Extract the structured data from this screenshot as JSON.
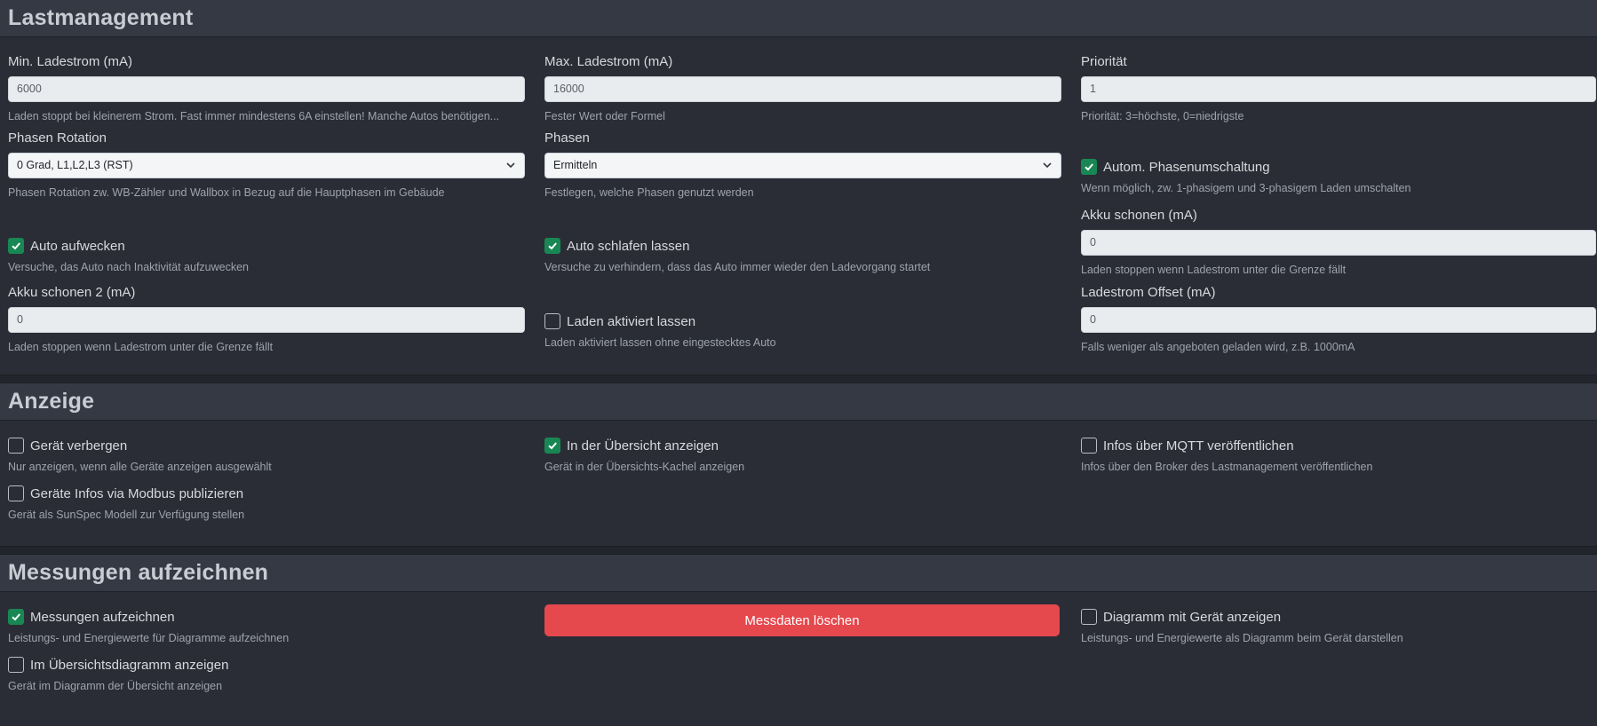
{
  "lastmanagement": {
    "title": "Lastmanagement",
    "min_ladestrom": {
      "label": "Min. Ladestrom (mA)",
      "value": "6000",
      "help": "Laden stoppt bei kleinerem Strom. Fast immer mindestens 6A einstellen! Manche Autos benötigen..."
    },
    "max_ladestrom": {
      "label": "Max. Ladestrom (mA)",
      "value": "16000",
      "help": "Fester Wert oder Formel"
    },
    "prioritaet": {
      "label": "Priorität",
      "value": "1",
      "help": "Priorität: 3=höchste, 0=niedrigste"
    },
    "phasen_rotation": {
      "label": "Phasen Rotation",
      "value": "0 Grad, L1,L2,L3 (RST)",
      "help": "Phasen Rotation zw. WB-Zähler und Wallbox in Bezug auf die Hauptphasen im Gebäude"
    },
    "phasen": {
      "label": "Phasen",
      "value": "Ermitteln",
      "help": "Festlegen, welche Phasen genutzt werden"
    },
    "autom_phasenumschaltung": {
      "label": "Autom. Phasenumschaltung",
      "checked": true,
      "help": "Wenn möglich, zw. 1-phasigem und 3-phasigem Laden umschalten"
    },
    "auto_aufwecken": {
      "label": "Auto aufwecken",
      "checked": true,
      "help": "Versuche, das Auto nach Inaktivität aufzuwecken"
    },
    "auto_schlafen": {
      "label": "Auto schlafen lassen",
      "checked": true,
      "help": "Versuche zu verhindern, dass das Auto immer wieder den Ladevorgang startet"
    },
    "akku_schonen": {
      "label": "Akku schonen (mA)",
      "value": "0",
      "help": "Laden stoppen wenn Ladestrom unter die Grenze fällt"
    },
    "akku_schonen2": {
      "label": "Akku schonen 2 (mA)",
      "value": "0",
      "help": "Laden stoppen wenn Ladestrom unter die Grenze fällt"
    },
    "laden_aktiviert": {
      "label": "Laden aktiviert lassen",
      "checked": false,
      "help": "Laden aktiviert lassen ohne eingestecktes Auto"
    },
    "ladestrom_offset": {
      "label": "Ladestrom Offset (mA)",
      "value": "0",
      "help": "Falls weniger als angeboten geladen wird, z.B. 1000mA"
    }
  },
  "anzeige": {
    "title": "Anzeige",
    "geraet_verbergen": {
      "label": "Gerät verbergen",
      "checked": false,
      "help": "Nur anzeigen, wenn alle Geräte anzeigen ausgewählt"
    },
    "uebersicht_anzeigen": {
      "label": "In der Übersicht anzeigen",
      "checked": true,
      "help": "Gerät in der Übersichts-Kachel anzeigen"
    },
    "mqtt": {
      "label": "Infos über MQTT veröffentlichen",
      "checked": false,
      "help": "Infos über den Broker des Lastmanagement veröffentlichen"
    },
    "modbus": {
      "label": "Geräte Infos via Modbus publizieren",
      "checked": false,
      "help": "Gerät als SunSpec Modell zur Verfügung stellen"
    }
  },
  "messungen": {
    "title": "Messungen aufzeichnen",
    "aufzeichnen": {
      "label": "Messungen aufzeichnen",
      "checked": true,
      "help": "Leistungs- und Energiewerte für Diagramme aufzeichnen"
    },
    "loeschen_button": "Messdaten löschen",
    "diagramm_geraet": {
      "label": "Diagramm mit Gerät anzeigen",
      "checked": false,
      "help": "Leistungs- und Energiewerte als Diagramm beim Gerät darstellen"
    },
    "uebersichtsdiagramm": {
      "label": "Im Übersichtsdiagramm anzeigen",
      "checked": false,
      "help": "Gerät im Diagramm der Übersicht anzeigen"
    }
  },
  "icons": {
    "checkmark": "check-icon",
    "dropdown": "chevron-down-icon"
  },
  "colors": {
    "background": "#2b2d36",
    "header": "#353944",
    "checked": "#198754",
    "danger": "#e5484d"
  }
}
